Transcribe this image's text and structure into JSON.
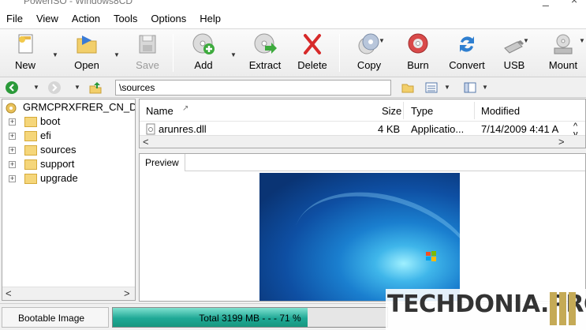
{
  "title_bar": {
    "title": "PowerISO - Windows8CD",
    "min_symbol": "_",
    "close_symbol": "×"
  },
  "menu": [
    "File",
    "View",
    "Action",
    "Tools",
    "Options",
    "Help"
  ],
  "toolbar": {
    "new": "New",
    "open": "Open",
    "save": "Save",
    "add": "Add",
    "extract": "Extract",
    "delete": "Delete",
    "copy": "Copy",
    "burn": "Burn",
    "convert": "Convert",
    "usb": "USB",
    "mount": "Mount"
  },
  "address": {
    "path": "\\sources"
  },
  "tree": {
    "root": "GRMCPRXFRER_CN_DVD",
    "folders": [
      "boot",
      "efi",
      "sources",
      "support",
      "upgrade"
    ]
  },
  "file_list": {
    "columns": {
      "name": "Name",
      "size": "Size",
      "type": "Type",
      "modified": "Modified"
    },
    "rows": [
      {
        "name": "arunres.dll",
        "size": "4 KB",
        "type": "Applicatio...",
        "modified": "7/14/2009 4:41 A"
      }
    ]
  },
  "preview": {
    "tab": "Preview"
  },
  "status": {
    "image_type": "Bootable Image",
    "progress_text": "Total  3199 MB   - - -  71 %",
    "progress_fraction": 0.71
  },
  "watermark": {
    "text": "TECHDONIA.PRO"
  },
  "colors": {
    "progress": "#1fa996",
    "folder": "#f5d67a",
    "watermark_bars": "#c5aa56"
  }
}
